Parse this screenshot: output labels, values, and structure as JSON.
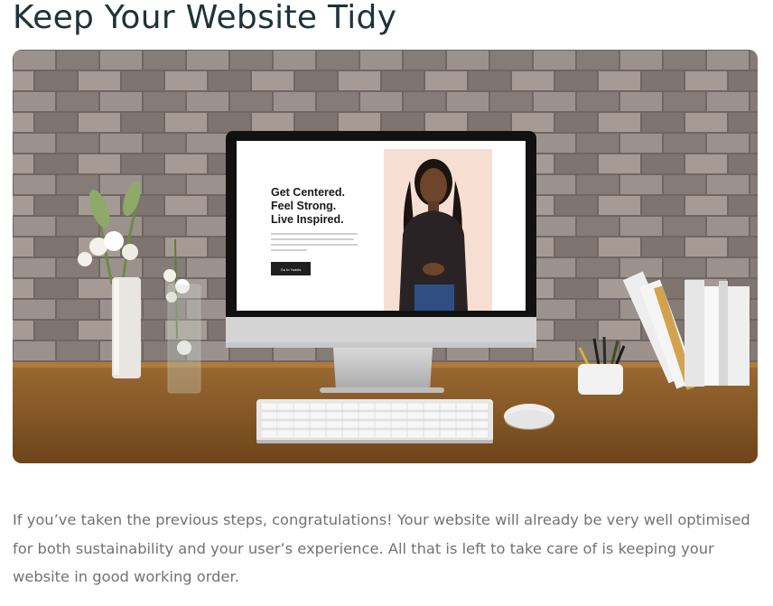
{
  "article": {
    "heading": "Keep Your Website Tidy",
    "paragraph": "If you’ve taken the previous steps, congratulations! Your website will already be very well optimised for both sustainability and your user’s experience. All that is left to take care of is keeping your website in good working order."
  },
  "monitor_screen": {
    "headline_line1": "Get Centered.",
    "headline_line2": "Feel Strong.",
    "headline_line3": "Live Inspired.",
    "button_label": "Go to Yoasts"
  },
  "colors": {
    "heading": "#1e3338",
    "body_text": "#727272",
    "screen_bg": "#ffffff",
    "portrait_bg": "#f6dfd2",
    "desk": "#8a5a26"
  }
}
